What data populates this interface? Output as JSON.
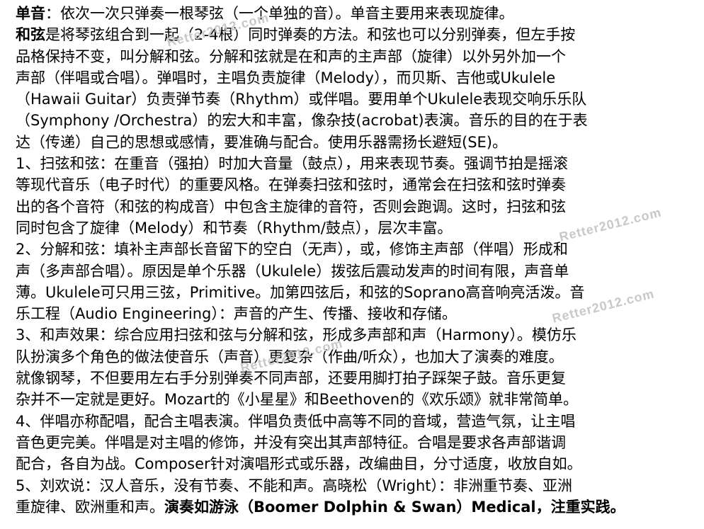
{
  "watermark": "Retter2012.com",
  "lines": [
    [
      {
        "t": "单音",
        "b": true
      },
      {
        "t": "：依次一次只弹奏一根琴弦（一个单独的音）。单音主要用来表现旋律。"
      }
    ],
    [
      {
        "t": "和弦",
        "b": true
      },
      {
        "t": "是将琴弦组合到一起（2-4根）同时弹奏的方法。和弦也可以分别弹奏，但左手按"
      }
    ],
    [
      {
        "t": "品格保持不变，叫分解和弦。分解和弦就是在和声的主声部（旋律）以外另外加一个"
      }
    ],
    [
      {
        "t": "声部（伴唱或合唱）。弹唱时，主唱负责旋律（Melody），而贝斯、吉他或Ukulele"
      }
    ],
    [
      {
        "t": "（Hawaii Guitar）负责弹节奏（Rhythm）或伴唱。要用单个Ukulele表现交响乐乐队"
      }
    ],
    [
      {
        "t": "（Symphony /Orchestra）的宏大和丰富，像杂技(acrobat)表演。音乐的目的在于表"
      }
    ],
    [
      {
        "t": "达（传递）自己的思想或感情，要准确与配合。使用乐器需扬长避短(SE)。"
      }
    ],
    [
      {
        "t": "1、扫弦和弦：在重音（强拍）时加大音量（鼓点），用来表现节奏。强调节拍是摇滚"
      }
    ],
    [
      {
        "t": "等现代音乐（电子时代）的重要风格。在弹奏扫弦和弦时，通常会在扫弦和弦时弹奏"
      }
    ],
    [
      {
        "t": "出的各个音符（和弦的构成音）中包含主旋律的音符，否则会跑调。这时，扫弦和弦"
      }
    ],
    [
      {
        "t": "同时包含了旋律（Melody）和节奏（Rhythm/鼓点），层次丰富。"
      }
    ],
    [
      {
        "t": "2、分解和弦：填补主声部长音留下的空白（无声），或，修饰主声部（伴唱）形成和"
      }
    ],
    [
      {
        "t": "声（多声部合唱）。原因是单个乐器（Ukulele）拨弦后震动发声的时间有限，声音单"
      }
    ],
    [
      {
        "t": "薄。Ukulele可只用三弦，Primitive。加第四弦后，和弦的Soprano高音响亮活泼。音"
      }
    ],
    [
      {
        "t": "乐工程（Audio Engineering）：声音的产生、传播、接收和存储。"
      }
    ],
    [
      {
        "t": "3、和声效果：综合应用扫弦和弦与分解和弦，形成多声部和声（Harmony）。模仿乐"
      }
    ],
    [
      {
        "t": "队扮演多个角色的做法使音乐（声音）更复杂（作曲/听众），也加大了演奏的难度。"
      }
    ],
    [
      {
        "t": "就像钢琴，不但要用左右手分别弹奏不同声部，还要用脚打拍子踩架子鼓。音乐更复"
      }
    ],
    [
      {
        "t": "杂并不一定就是更好。Mozart的《小星星》和Beethoven的《欢乐颂》就非常简单。"
      }
    ],
    [
      {
        "t": "4、伴唱亦称配唱，配合主唱表演。伴唱负责低中高等不同的音域，营造气氛，让主唱"
      }
    ],
    [
      {
        "t": "音色更完美。伴唱是对主唱的修饰，并没有突出其声部特征。合唱是要求各声部谐调"
      }
    ],
    [
      {
        "t": "配合，各自为战。Composer针对演唱形式或乐器，改编曲目，分寸适度，收放自如。"
      }
    ],
    [
      {
        "t": "5、刘欢说：汉人音乐，没有节奏、不能和声。高晓松（Wright）：非洲重节奏、亚洲"
      }
    ],
    [
      {
        "t": "重旋律、欧洲重和声。"
      },
      {
        "t": "演奏如游泳（Boomer Dolphin & Swan）Medical，注重实践。",
        "b": true
      }
    ]
  ]
}
